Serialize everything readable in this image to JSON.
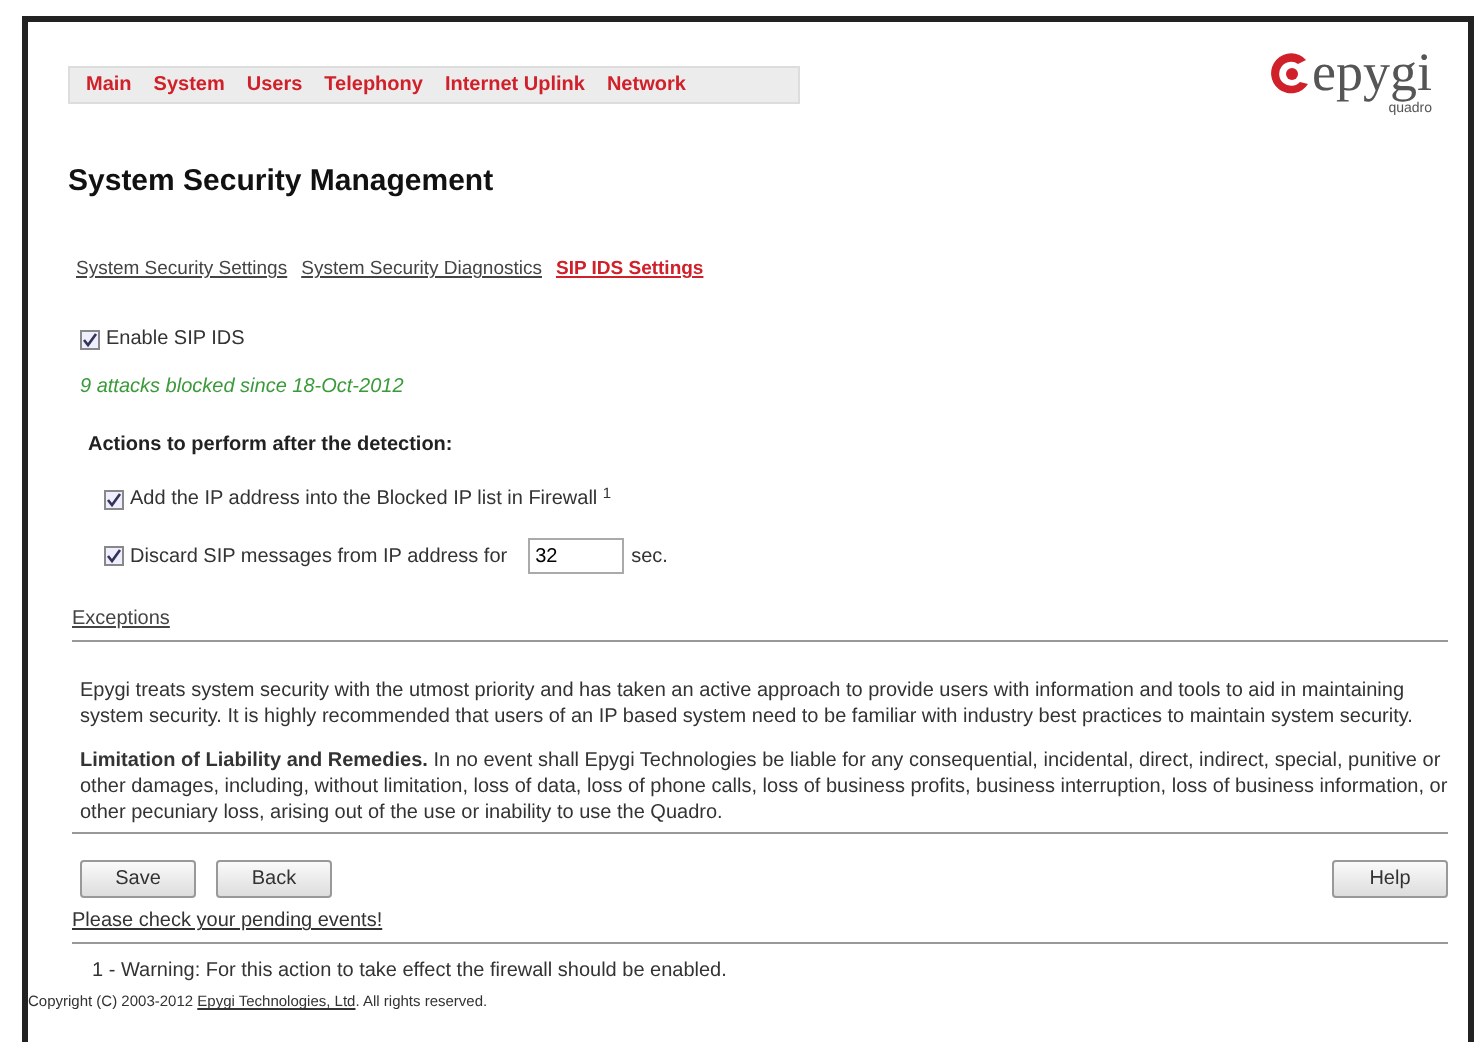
{
  "menu": [
    {
      "label": "Main"
    },
    {
      "label": "System"
    },
    {
      "label": "Users"
    },
    {
      "label": "Telephony"
    },
    {
      "label": "Internet Uplink"
    },
    {
      "label": "Network"
    }
  ],
  "logo": {
    "brand": "epygi",
    "product": "quadro"
  },
  "title": "System Security Management",
  "subtabs": [
    {
      "label": "System Security Settings",
      "selected": false
    },
    {
      "label": "System Security Diagnostics",
      "selected": false
    },
    {
      "label": "SIP IDS Settings",
      "selected": true
    }
  ],
  "enable": {
    "label": "Enable SIP IDS",
    "checked": true
  },
  "status": "9 attacks blocked since 18-Oct-2012",
  "actions_heading": "Actions to perform after the detection:",
  "actions": [
    {
      "kind": "checkbox",
      "label": "Add the IP address into the Blocked IP list in Firewall $^{1}$",
      "checked": true
    },
    {
      "kind": "timed",
      "label": "Discard SIP messages from IP address for",
      "checked": true,
      "value": "32",
      "unit": "sec."
    }
  ],
  "exceptions_link": "Exceptions",
  "paragraphs": [
    "Epygi treats system security with the utmost priority and has taken an active approach to provide users with information and tools to aid in maintaining system security. It is highly recommended that users of an IP based system need to be familiar with industry best practices to maintain system security.",
    "**Limitation of Liability and Remedies.** In no event shall Epygi Technologies be liable for any consequential, incidental, direct, indirect, special, punitive or other damages, including, without limitation, loss of data, loss of phone calls, loss of business profits, business interruption, loss of business information, or other pecuniary loss, arising out of the use or inability to use the Quadro."
  ],
  "buttons": [
    {
      "label": "Save",
      "kind": "left"
    },
    {
      "label": "Back",
      "kind": "left"
    },
    {
      "label": "Help",
      "kind": "right"
    }
  ],
  "pending_link": "Please check your pending events!",
  "footnote": "1 - Warning: For this action to take effect the firewall should be enabled.",
  "copyright": {
    "before": "Copyright (C) 2003-2012 ",
    "link": "Epygi Technologies, Ltd",
    "after": ". All rights reserved."
  }
}
